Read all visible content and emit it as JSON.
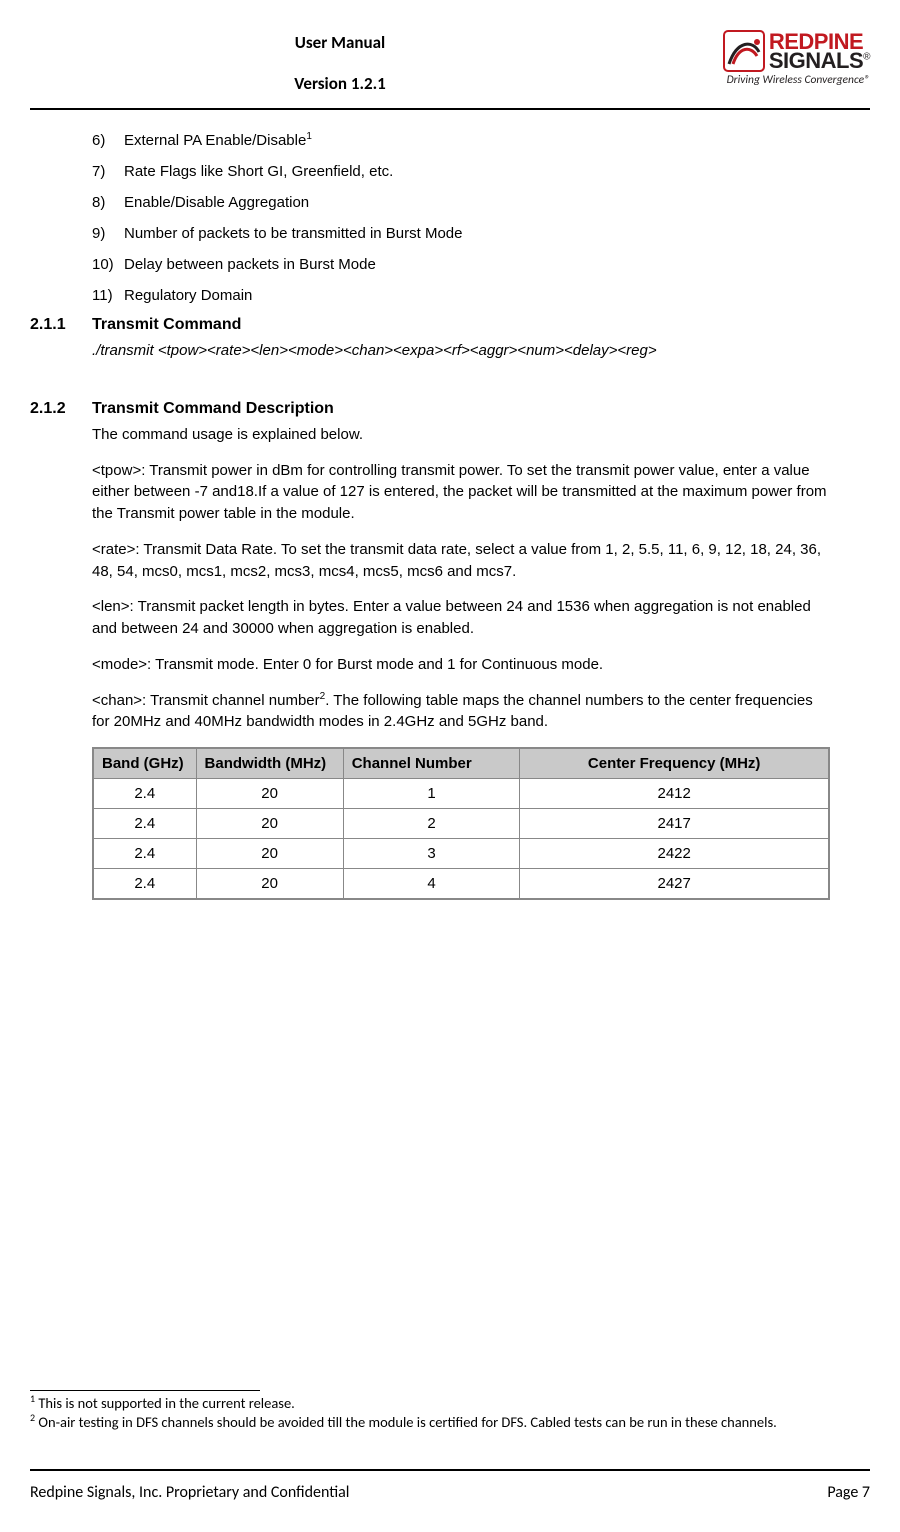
{
  "header": {
    "title": "User Manual",
    "version": "Version 1.2.1",
    "logo": {
      "line1": "REDPINE",
      "line2": "SIGNALS",
      "reg": "®",
      "tagline_prefix": "Driving Wireless Convergence",
      "tagline_reg": "®"
    }
  },
  "list": {
    "items": [
      {
        "n": "6)",
        "text_a": "External PA Enable/Disable",
        "sup": "1",
        "text_b": ""
      },
      {
        "n": "7)",
        "text_a": "Rate Flags like Short GI, Greenfield, etc.",
        "sup": "",
        "text_b": ""
      },
      {
        "n": "8)",
        "text_a": "Enable/Disable Aggregation",
        "sup": "",
        "text_b": ""
      },
      {
        "n": "9)",
        "text_a": "Number of packets to be transmitted in Burst Mode",
        "sup": "",
        "text_b": ""
      },
      {
        "n": "10)",
        "text_a": "Delay between packets in Burst Mode",
        "sup": "",
        "text_b": ""
      },
      {
        "n": "11)",
        "text_a": "Regulatory Domain",
        "sup": "",
        "text_b": ""
      }
    ]
  },
  "sec211": {
    "num": "2.1.1",
    "title": "Transmit Command",
    "cmd": "./transmit <tpow><rate><len><mode><chan><expa><rf><aggr><num><delay><reg>"
  },
  "sec212": {
    "num": "2.1.2",
    "title": "Transmit Command Description",
    "intro": "The command usage is explained below.",
    "p_tpow": "<tpow>: Transmit power in dBm for controlling transmit power. To set the transmit power value, enter a value either between -7 and18.If a value of 127 is entered, the packet will be transmitted at the maximum power from the Transmit power table in the module.",
    "p_rate": "<rate>: Transmit Data Rate. To set the transmit data rate, select a value from 1, 2, 5.5, 11, 6, 9, 12, 18, 24, 36, 48, 54, mcs0, mcs1, mcs2, mcs3, mcs4, mcs5, mcs6 and mcs7.",
    "p_len": "<len>: Transmit packet length in bytes. Enter a value between 24 and 1536 when aggregation is not enabled and between 24 and 30000 when aggregation is enabled.",
    "p_mode": "<mode>: Transmit mode. Enter 0 for Burst mode and 1 for Continuous mode.",
    "p_chan_a": "<chan>: Transmit channel number",
    "p_chan_sup": "2",
    "p_chan_b": ". The following table maps the channel numbers to the center frequencies for 20MHz and 40MHz bandwidth modes in 2.4GHz and 5GHz band."
  },
  "table": {
    "headers": {
      "band": "Band (GHz)",
      "bw": "Bandwidth (MHz)",
      "chan": "Channel Number",
      "freq": "Center Frequency (MHz)"
    },
    "rows": [
      {
        "band": "2.4",
        "bw": "20",
        "chan": "1",
        "freq": "2412"
      },
      {
        "band": "2.4",
        "bw": "20",
        "chan": "2",
        "freq": "2417"
      },
      {
        "band": "2.4",
        "bw": "20",
        "chan": "3",
        "freq": "2422"
      },
      {
        "band": "2.4",
        "bw": "20",
        "chan": "4",
        "freq": "2427"
      }
    ]
  },
  "footnotes": {
    "f1_sup": "1",
    "f1": " This is not supported in the current release.",
    "f2_sup": "2",
    "f2": " On-air testing in DFS channels should be avoided till the module is certified for DFS. Cabled tests can be run in these channels."
  },
  "footer": {
    "left": "Redpine Signals, Inc. Proprietary and Confidential",
    "right": "Page 7"
  }
}
